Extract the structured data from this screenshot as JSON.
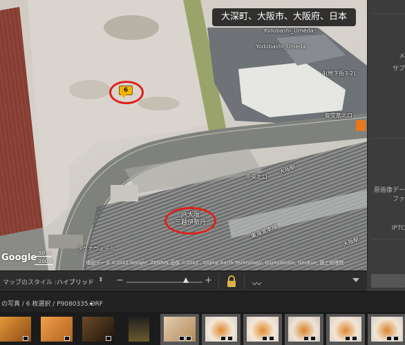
{
  "map": {
    "location_banner": "大深町、大阪市、大阪府、日本",
    "labels": {
      "yodobashi_1": "Yodobashi_Umeda",
      "yodobashi_2": "Yodobashi_Umeda",
      "exit_4": "4(地下街3-2)",
      "midosuji_north": "御堂筋北口",
      "central_north": "中央北口",
      "tokaido_line": "東海道本線",
      "osaka_station": "大阪駅",
      "osaka_station_2": "大阪駅",
      "lagrande": "ラグナヴェール",
      "jr_osaka_line1": "JR大阪",
      "jr_osaka_line2": "三越伊勢丹"
    },
    "pin_count": "6",
    "google_logo": "Google",
    "scale_top": "50 m",
    "scale_bottom": "200 ft",
    "copyright": "地図データ ©2012 Google, ZENRIN 画像 ©2012 , Digital Earth Technology, DigitalGlobe, GeoEye, 國土地理院"
  },
  "right_panel": {
    "labels": [
      "メ",
      "サブ",
      "原画像デー",
      "ファ",
      "IPTC"
    ]
  },
  "toolbar": {
    "map_style_label": "マップのスタイル :",
    "map_style_value": "ハイブリッド",
    "minus": "−",
    "plus": "+",
    "zoom_level": 0.75
  },
  "filmstrip_header": {
    "path": "の写真 / 6 枚選択 / P9080335.ORF"
  },
  "filmstrip": {
    "thumbnails": [
      "orange-room",
      "orange-interior",
      "night-scene",
      "dark-door",
      "hotel-room",
      "food-bowl",
      "food-bowl",
      "food-bowl",
      "food-bowl",
      "food-bowl"
    ]
  },
  "colors": {
    "highlight_red": "#e0201a",
    "badge_yellow": "#f2b300",
    "accent_orange": "#e87819"
  }
}
